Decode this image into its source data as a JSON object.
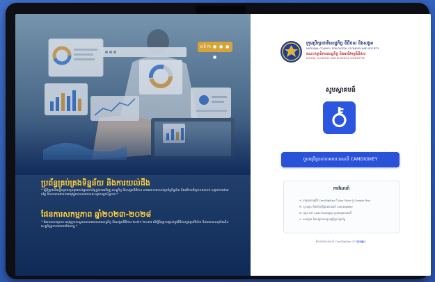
{
  "brand": {
    "org_name_km": "ក្រុមប្រឹក្សាជាតិសេដ្ឋកិច្ច ឌីជីថល និងសង្គម",
    "org_name_en": "NATIONAL COUNCIL FOR DIGITAL ECONOMY AND SOCIETY",
    "committee_km": "គណៈកម្មាធិការសេដ្ឋកិច្ច និងអាជីវកម្មឌីជីថល",
    "committee_en": "DIGITAL ECONOMY AND BUSINESS COMMITTEE"
  },
  "hero": {
    "pill_label": "វេទិកា",
    "pill_dots": "● ● ● ●",
    "heading_1": "ប្រព័ន្ធគ្រប់គ្រងទិន្នន័យ និងការយល់ដឹង",
    "paragraph_1": "* ធ្វើឱ្យប្រសើរឡើងនូវការចូលរួមរបស់អ្នកពាក់ព័ន្ធក្នុងការអភិវឌ្ឍ សេដ្ឋកិច្ច និងសង្គមឌីជីថល តាមរយៈការកសាងប្រព័ន្ធទិន្នន័យ និងវេទិការពិគ្រោះយោបល់ សម្រាប់ការវាយតម្លៃ និងការតាមដានការអនុវត្តគោលនយោបាយ ឲ្យមានប្រសិទ្ធភាព *",
    "heading_2": "ផែនការសកម្មភាព ឆ្នាំ២០២៣-២០២៨",
    "paragraph_2": "* ផែនការសកម្មភាព អនុវត្តក្របខណ្ឌគោលនយោបាយសេដ្ឋកិច្ច និងសង្គមឌីជីថល ២០២១-២០៣៥ ដើម្បីជំរុញការផ្លាស់ប្តូរឌីជីថលក្នុងគ្រប់វិស័យ និងធានាបាននូវកំណើនសេដ្ឋកិច្ចប្រកបដោយបរិយាបន្ន *"
  },
  "login": {
    "welcome": "សូមស្វាគមន៍",
    "key_icon": "camdigikey-key-icon",
    "button_label": "ចូលប្រើប្រាស់តាមរយៈគណនី CAMDIGIKEY",
    "guide_title": "ការណែនាំ",
    "steps": [
      "១. ទាញយកកម្មវិធី CamDigiKey ពី App Store ឬ Google Play",
      "២. ចុះឈ្មោះ និងបើកប្រើប្រាស់គណនី CamDigiKey",
      "៣. ស្កេន QR Code ដែលបង្ហាញ ឬចុចប៊ូតុងខាងលើ",
      "៤. យល់ព្រម និងបញ្ជាក់ការចូលប្រើប្រាស់ប្រព័ន្ធ"
    ],
    "help_text": "មិនទាន់មានគណនី CamDigiKey ទេ?",
    "help_link": "ចុះឈ្មោះ"
  },
  "colors": {
    "accent_blue": "#2a52d8",
    "heading_gold": "#ffcf3a",
    "seal_blue": "#1c3f95",
    "seal_gold": "#e1b33a",
    "dark_navy": "#0f2a57"
  }
}
